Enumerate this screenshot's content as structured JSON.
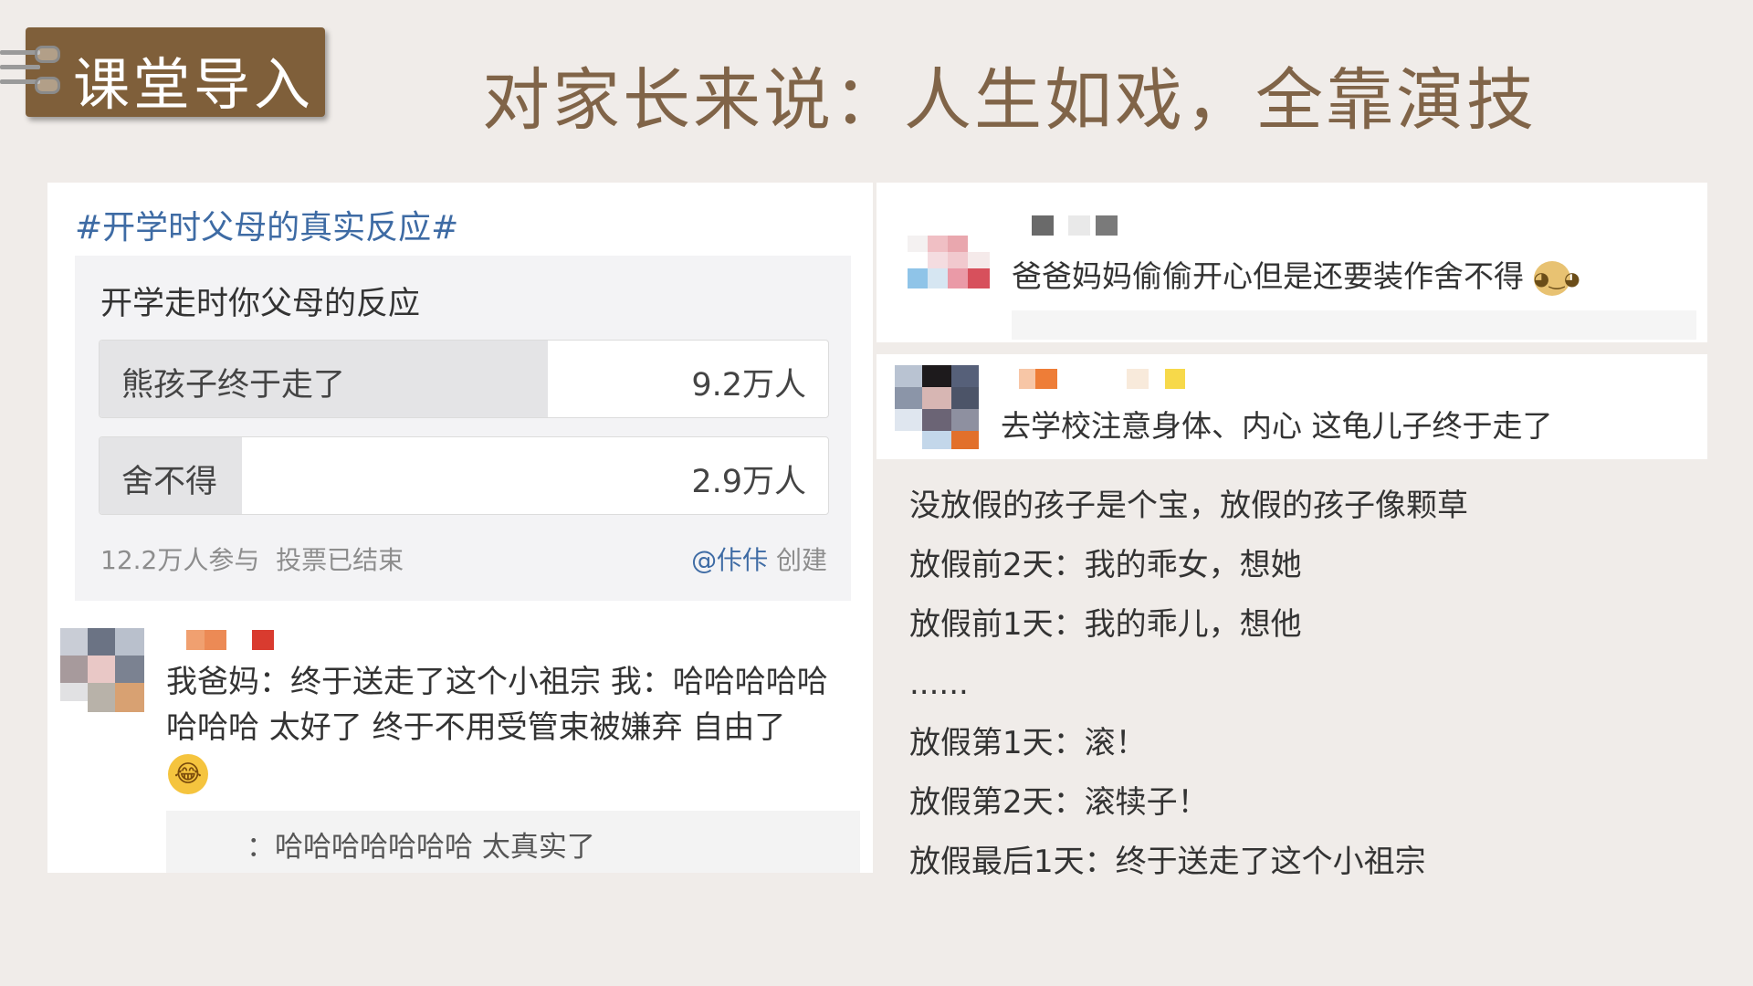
{
  "header": {
    "tag_label": "课堂导入",
    "title": "对家长来说：人生如戏，全靠演技"
  },
  "post": {
    "hashtag": "#开学时父母的真实反应#",
    "poll": {
      "question": "开学走时你父母的反应",
      "options": [
        {
          "label": "熊孩子终于走了",
          "count": "9.2万人",
          "share": 0.76
        },
        {
          "label": "舍不得",
          "count": "2.9万人",
          "share": 0.24
        }
      ],
      "participants": "12.2万人参与",
      "status": "投票已结束",
      "creator_handle": "@佧佧",
      "creator_suffix": "创建"
    },
    "comment": {
      "text": "我爸妈：终于送走了这个小祖宗 我：哈哈哈哈哈哈哈哈  太好了 终于不用受管束被嫌弃 自由了",
      "emoji": "laughing-emoji",
      "reply": "：哈哈哈哈哈哈哈 太真实了"
    }
  },
  "right_comments": [
    {
      "text": "爸爸妈妈偷偷开心但是还要装作舍不得",
      "emoji": "doge-emoji"
    },
    {
      "text": "去学校注意身体、内心 这龟儿子终于走了"
    }
  ],
  "poem": [
    "没放假的孩子是个宝，放假的孩子像颗草",
    "放假前2天：我的乖女，想她",
    "放假前1天：我的乖儿，想他",
    "......",
    "放假第1天：滚！",
    "放假第2天：滚犊子！",
    "放假最后1天：终于送走了这个小祖宗"
  ],
  "colors": {
    "background": "#f0ece9",
    "tag": "#7f5f3a",
    "title": "#806448",
    "link_blue": "#3e6ba4"
  }
}
